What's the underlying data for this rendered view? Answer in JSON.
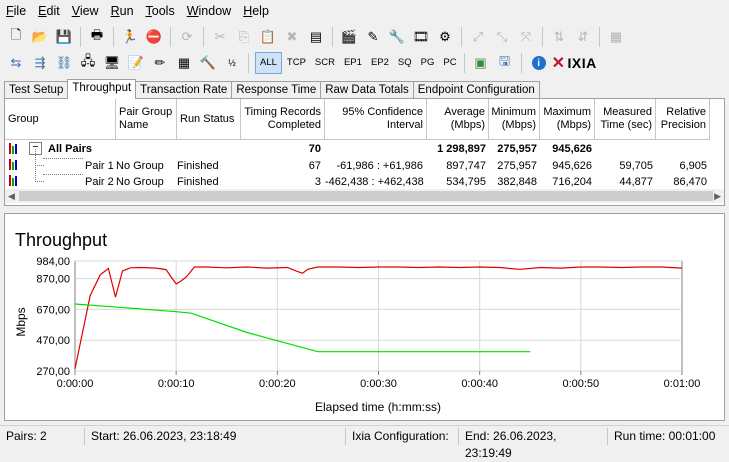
{
  "menu": [
    "File",
    "Edit",
    "View",
    "Run",
    "Tools",
    "Window",
    "Help"
  ],
  "toolbar2": {
    "buttons": [
      "ALL",
      "TCP",
      "SCR",
      "EP1",
      "EP2",
      "SQ",
      "PG",
      "PC"
    ],
    "brand": "IXIA"
  },
  "tabs": [
    "Test Setup",
    "Throughput",
    "Transaction Rate",
    "Response Time",
    "Raw Data Totals",
    "Endpoint Configuration"
  ],
  "active_tab": "Throughput",
  "table": {
    "headers": {
      "group": "Group",
      "pair_group_name": "Pair Group Name",
      "run_status": "Run Status",
      "timing_records": "Timing Records Completed",
      "confidence": "95% Confidence Interval",
      "average": "Average (Mbps)",
      "minimum": "Minimum (Mbps)",
      "maximum": "Maximum (Mbps)",
      "measured_time": "Measured Time (sec)",
      "relative_precision": "Relative Precision"
    },
    "all_pairs": {
      "label": "All Pairs",
      "timing": "70",
      "average": "1 298,897",
      "minimum": "275,957",
      "maximum": "945,626"
    },
    "rows": [
      {
        "pair": "Pair 1",
        "group": "No Group",
        "status": "Finished",
        "timing": "67",
        "confidence": "-61,986 : +61,986",
        "average": "897,747",
        "minimum": "275,957",
        "maximum": "945,626",
        "measured": "59,705",
        "precision": "6,905"
      },
      {
        "pair": "Pair 2",
        "group": "No Group",
        "status": "Finished",
        "timing": "3",
        "confidence": "-462,438 : +462,438",
        "average": "534,795",
        "minimum": "382,848",
        "maximum": "716,204",
        "measured": "44,877",
        "precision": "86,470"
      }
    ]
  },
  "chart_data": {
    "type": "line",
    "title": "Throughput",
    "xlabel": "Elapsed time (h:mm:ss)",
    "ylabel": "Mbps",
    "xlim": [
      0,
      60
    ],
    "ylim": [
      270,
      984
    ],
    "y_ticks": [
      "984,00",
      "870,00",
      "670,00",
      "470,00",
      "270,00"
    ],
    "y_tick_values": [
      984,
      870,
      670,
      470,
      270
    ],
    "x_ticks": [
      "0:00:00",
      "0:00:10",
      "0:00:20",
      "0:00:30",
      "0:00:40",
      "0:00:50",
      "0:01:00"
    ],
    "x_tick_values": [
      0,
      10,
      20,
      30,
      40,
      50,
      60
    ],
    "grid": true,
    "series": [
      {
        "color": "#e00000",
        "x": [
          0,
          1.5,
          2.5,
          3.3,
          4.0,
          4.7,
          5.5,
          6.5,
          8.0,
          9.0,
          9.5,
          10.0,
          10.5,
          11.0,
          11.8,
          13.0,
          15.0,
          17.0,
          19.0,
          21.0,
          22.0,
          22.5,
          23.0,
          24.0,
          26.0,
          28.0,
          30.0,
          32.0,
          34.0,
          36.0,
          38.0,
          40.0,
          42.0,
          43.0,
          44.0,
          46.0,
          48.0,
          50.0,
          52.0,
          54.0,
          56.0,
          58.0,
          60.0
        ],
        "y": [
          285,
          760,
          895,
          935,
          750,
          920,
          940,
          942,
          938,
          928,
          880,
          835,
          855,
          880,
          945,
          945,
          940,
          945,
          938,
          942,
          915,
          905,
          930,
          945,
          945,
          942,
          945,
          945,
          942,
          945,
          942,
          945,
          942,
          935,
          930,
          942,
          938,
          945,
          945,
          942,
          945,
          945,
          938
        ]
      },
      {
        "color": "#00e000",
        "x": [
          0,
          5,
          10,
          11.5,
          17.0,
          24.0,
          30.0,
          36.0,
          40.0,
          45.0
        ],
        "y": [
          705,
          680,
          655,
          645,
          520,
          395,
          395,
          395,
          395,
          395
        ]
      }
    ]
  },
  "status": {
    "pairs": "Pairs: 2",
    "start": "Start: 26.06.2023, 23:18:49",
    "ixia_config": "Ixia Configuration:",
    "end": "End: 26.06.2023, 23:19:49",
    "run_time": "Run time: 00:01:00"
  }
}
